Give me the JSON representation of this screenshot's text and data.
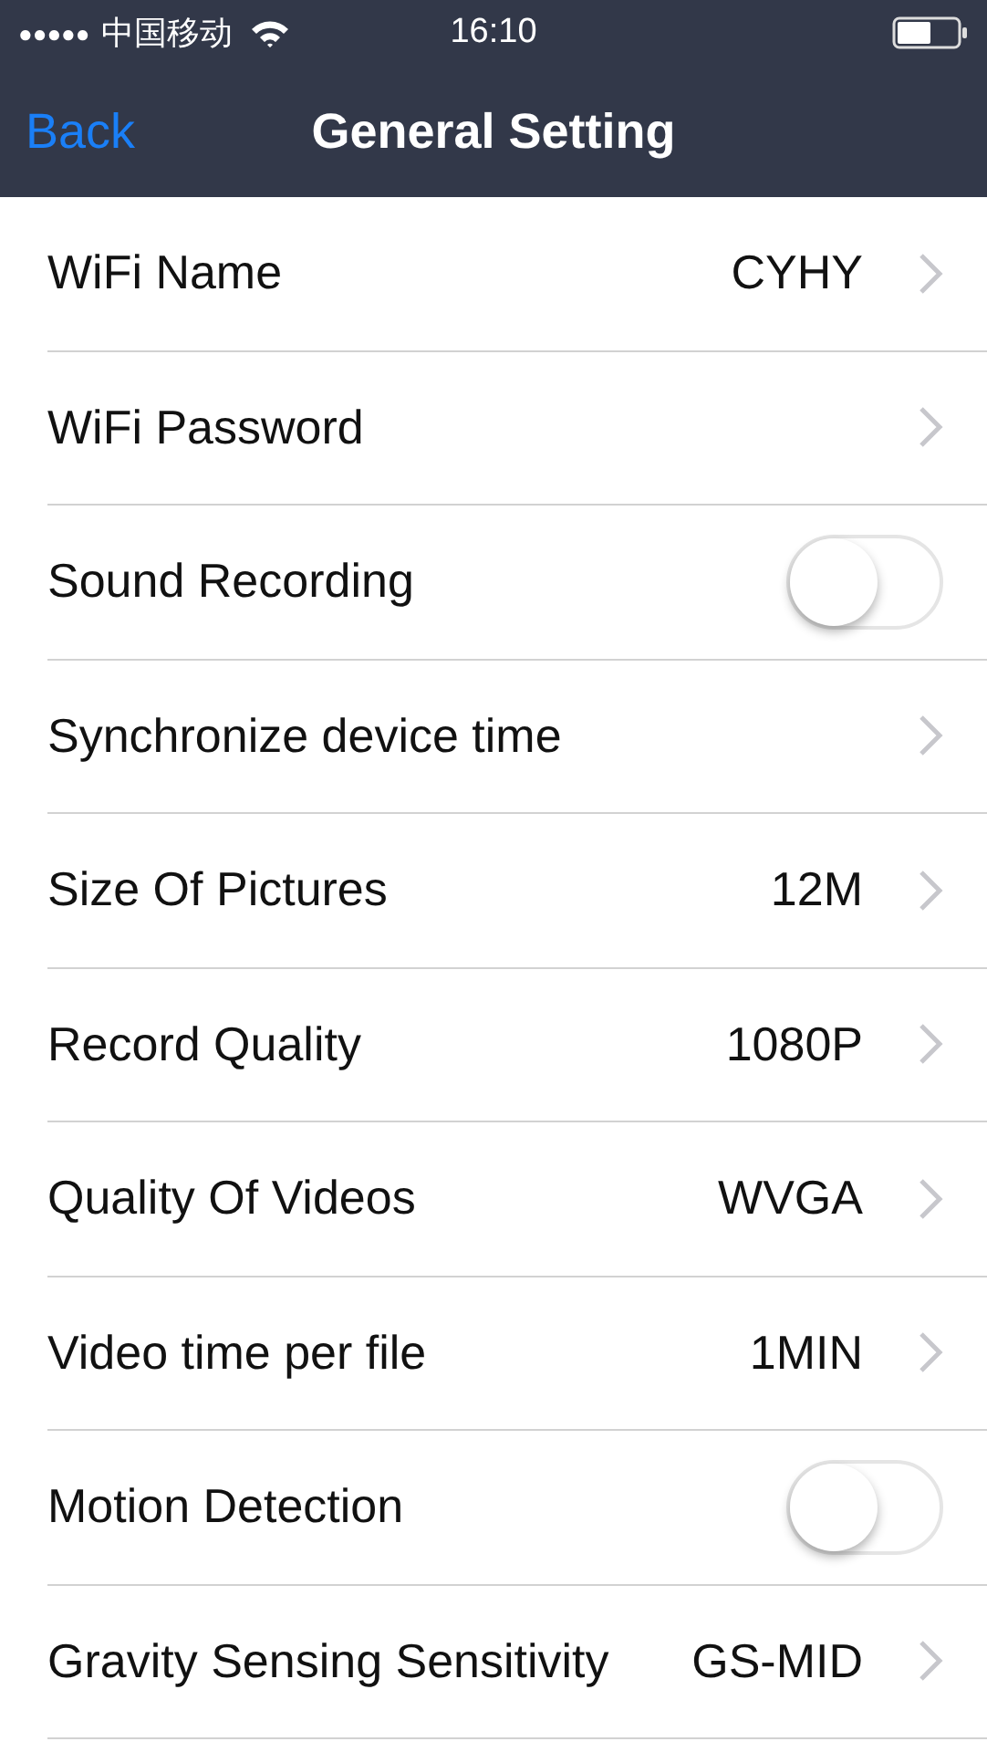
{
  "status_bar": {
    "signal_dots": "●●●●●",
    "carrier": "中国移动",
    "time": "16:10"
  },
  "nav": {
    "back": "Back",
    "title": "General Setting"
  },
  "settings": [
    {
      "kind": "chevron",
      "label": "WiFi Name",
      "value": "CYHY"
    },
    {
      "kind": "chevron",
      "label": "WiFi Password"
    },
    {
      "kind": "toggle",
      "label": "Sound Recording",
      "on": false
    },
    {
      "kind": "chevron",
      "label": "Synchronize device time"
    },
    {
      "kind": "chevron",
      "label": "Size Of Pictures",
      "value": "12M"
    },
    {
      "kind": "chevron",
      "label": "Record Quality",
      "value": "1080P"
    },
    {
      "kind": "chevron",
      "label": "Quality Of Videos",
      "value": "WVGA"
    },
    {
      "kind": "chevron",
      "label": "Video time per file",
      "value": "1MIN"
    },
    {
      "kind": "toggle",
      "label": "Motion Detection",
      "on": false
    },
    {
      "kind": "chevron",
      "label": "Gravity Sensing Sensitivity",
      "value": "GS-MID"
    }
  ]
}
